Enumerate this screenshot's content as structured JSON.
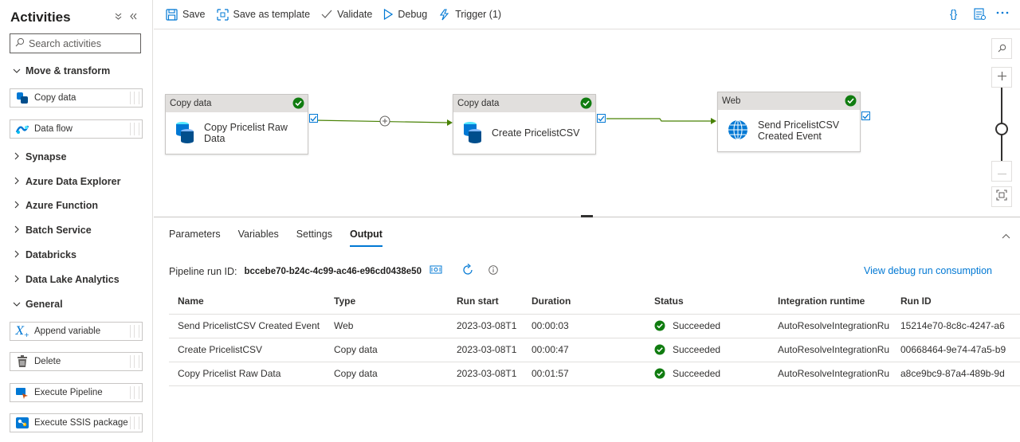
{
  "sidebar": {
    "title": "Activities",
    "search_placeholder": "Search activities",
    "categories": {
      "move_transform": "Move & transform",
      "synapse": "Synapse",
      "azure_data_explorer": "Azure Data Explorer",
      "azure_function": "Azure Function",
      "batch_service": "Batch Service",
      "databricks": "Databricks",
      "data_lake_analytics": "Data Lake Analytics",
      "general": "General"
    },
    "items": {
      "copy_data": "Copy data",
      "data_flow": "Data flow",
      "append_variable": "Append variable",
      "delete": "Delete",
      "execute_pipeline": "Execute Pipeline",
      "execute_ssis": "Execute SSIS package"
    }
  },
  "toolbar": {
    "save": "Save",
    "save_as_template": "Save as template",
    "validate": "Validate",
    "debug": "Debug",
    "trigger": "Trigger (1)",
    "code_icon": "{}"
  },
  "canvas": {
    "nodes": [
      {
        "type": "Copy data",
        "name_line1": "Copy Pricelist Raw",
        "name_line2": "Data"
      },
      {
        "type": "Copy data",
        "name_line1": "Create PricelistCSV",
        "name_line2": ""
      },
      {
        "type": "Web",
        "name_line1": "Send PricelistCSV",
        "name_line2": "Created Event"
      }
    ]
  },
  "panel": {
    "tabs": [
      "Parameters",
      "Variables",
      "Settings",
      "Output"
    ],
    "active_tab": "Output",
    "run_id_label": "Pipeline run ID:",
    "run_id": "bccebe70-b24c-4c99-ac46-e96cd0438e50",
    "view_link": "View debug run consumption",
    "columns": [
      "Name",
      "Type",
      "Run start",
      "Duration",
      "Status",
      "Integration runtime",
      "Run ID"
    ],
    "rows": [
      {
        "name": "Send PricelistCSV Created Event",
        "type": "Web",
        "run_start": "2023-03-08T1",
        "duration": "00:00:03",
        "status": "Succeeded",
        "runtime": "AutoResolveIntegrationRu",
        "run_id": "15214e70-8c8c-4247-a6"
      },
      {
        "name": "Create PricelistCSV",
        "type": "Copy data",
        "run_start": "2023-03-08T1",
        "duration": "00:00:47",
        "status": "Succeeded",
        "runtime": "AutoResolveIntegrationRu",
        "run_id": "00668464-9e74-47a5-b9"
      },
      {
        "name": "Copy Pricelist Raw Data",
        "type": "Copy data",
        "run_start": "2023-03-08T1",
        "duration": "00:01:57",
        "status": "Succeeded",
        "runtime": "AutoResolveIntegrationRu",
        "run_id": "a8ce9bc9-87a4-489b-9d"
      }
    ]
  },
  "colors": {
    "accent": "#0078d4",
    "success": "#107c10",
    "connector": "#498205"
  }
}
